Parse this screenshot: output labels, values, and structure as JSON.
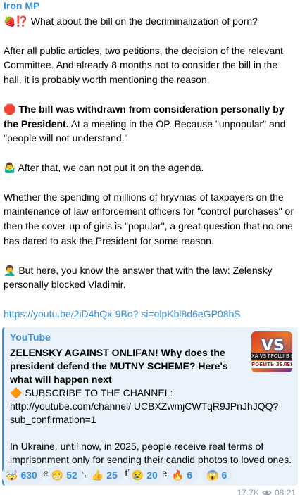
{
  "channel": {
    "name": "Iron MP"
  },
  "post": {
    "line1": "🍓⁉️ What about the bill on the decriminalization of porn?",
    "para2": "After all public articles, two petitions, the decision of the relevant Committee. And already 8 months not to consider the bill in the hall, it is probably worth mentioning the reason.",
    "para3_emoji": "🛑",
    "para3_bold": "The bill was withdrawn from consideration personally by the President.",
    "para3_rest": " At a meeting in the OP. Because \"unpopular\" and \"people will not understand.\"",
    "para4": "🤷‍♂️ After that, we can not put it on the agenda.",
    "para5": "Whether the spending of millions of hryvnias of taxpayers on the maintenance of law enforcement officers for \"control purchases\" or then the cover-up of girls is \"popular\", a great question that no one has dared to ask the President for some reason.",
    "para6": "🤦‍♂️ But here, you know the answer that with the law: Zelensky personally blocked Vladimir.",
    "link": "https://youtu.be/2iD4hQx-9Bo? si=olpKbl8d6eGP08bS"
  },
  "preview": {
    "site": "YouTube",
    "title": "ZELENSKY AGAINST ONLIFAN! Why does the president defend the MUTNY SCHEME? Here's what will happen next",
    "line1": "🔶 SUBSCRIBE TO THE CHANNEL: http://youtube.com/channel/ UCBXZwmjCWTqR9JPnJhJQQ? sub_confirmation=1",
    "line2": "In Ukraine, until now, in 2025, people receive real terms of imprisonment only for sending their candid photos to loved ones. At the same time, pros on the Inflike...",
    "thumb_vs": "VS",
    "thumb_text1": "ХА VS ГРОШІ В БЮ",
    "thumb_text2": "РОБИТЬ ЗЕЛЕНСЬ"
  },
  "reactions": [
    {
      "emoji": "🤯",
      "count": "630"
    },
    {
      "emoji": "😁",
      "count": "52"
    },
    {
      "emoji": "👍",
      "count": "25"
    },
    {
      "emoji": "😢",
      "count": "20"
    },
    {
      "emoji": "🔥",
      "count": "6"
    },
    {
      "emoji": "😱",
      "count": "6"
    }
  ],
  "footer": {
    "views": "17.7K",
    "time": "08:21"
  },
  "icons": {
    "views": "eye-icon"
  },
  "colors": {
    "accent": "#3a8fd9",
    "preview_bg": "#eaf3fc",
    "reaction_bg": "#e3eefa",
    "meta": "#8a9aa8"
  }
}
